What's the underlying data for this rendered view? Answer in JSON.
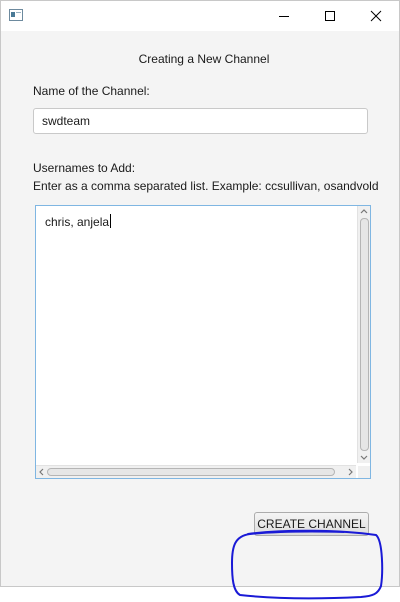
{
  "window": {
    "controls": {
      "minimize_icon": "minimize-icon",
      "maximize_icon": "maximize-icon",
      "close_icon": "close-icon"
    }
  },
  "form": {
    "heading": "Creating a New Channel",
    "name_label": "Name of the Channel:",
    "name_value": "swdteam",
    "users_label": "Usernames to Add:",
    "users_hint": "Enter as a comma separated list. Example: ccsullivan, osandvold",
    "users_value": "chris, anjela",
    "create_button_label": "CREATE CHANNEL"
  },
  "annotation": {
    "color": "#1a1ad6"
  }
}
